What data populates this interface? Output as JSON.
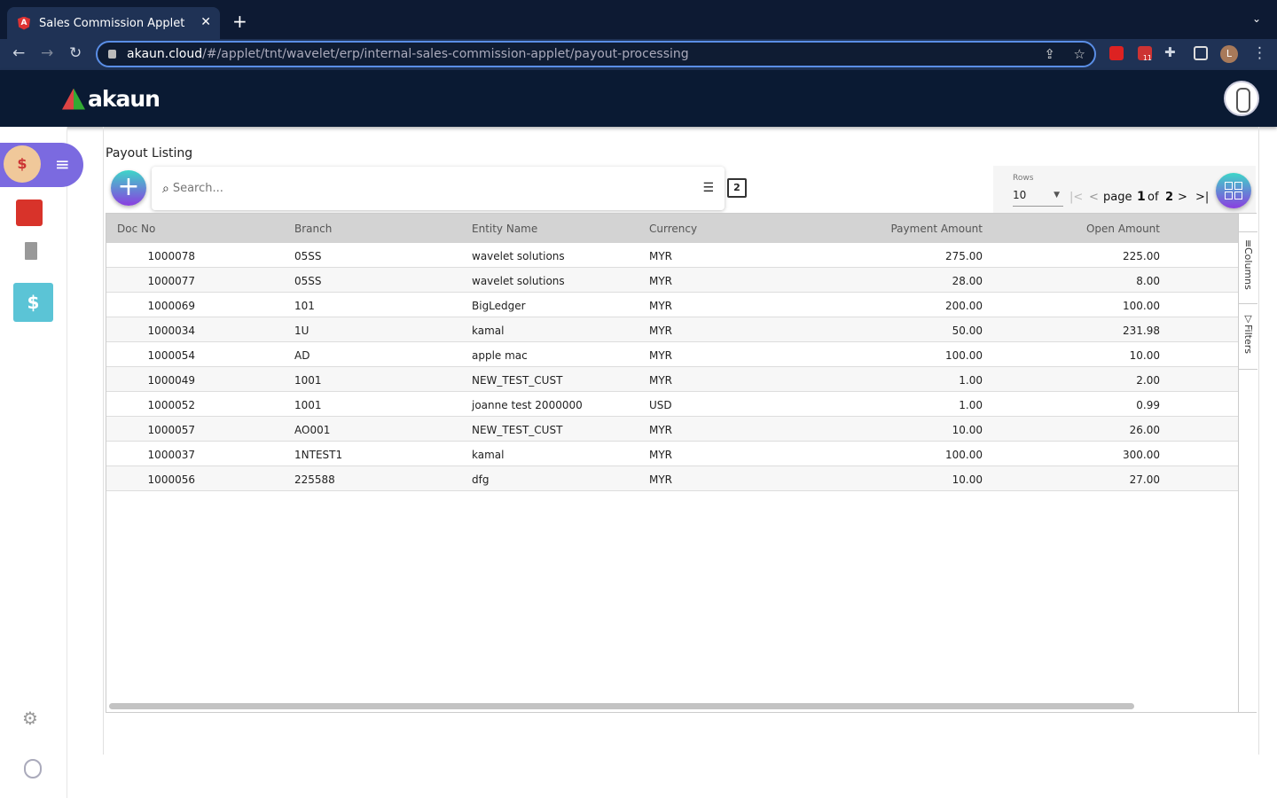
{
  "browser": {
    "tab_title": "Sales Commission Applet",
    "url_host": "akaun.cloud",
    "url_path": "/#/applet/tnt/wavelet/erp/internal-sales-commission-applet/payout-processing",
    "profile_initial": "L",
    "ext_badge": "11"
  },
  "app": {
    "logo_text": "akaun"
  },
  "page": {
    "title": "Payout Listing",
    "search_placeholder": "Search...",
    "copy_icon_label": "2"
  },
  "pager": {
    "rows_label": "Rows",
    "rows_value": "10",
    "page_word": "page",
    "page": "1",
    "of_word": "of",
    "total": "2"
  },
  "table": {
    "columns": [
      "Doc No",
      "Branch",
      "Entity Name",
      "Currency",
      "Payment Amount",
      "Open Amount"
    ],
    "rows": [
      [
        "1000078",
        "05SS",
        "wavelet solutions",
        "MYR",
        "275.00",
        "225.00"
      ],
      [
        "1000077",
        "05SS",
        "wavelet solutions",
        "MYR",
        "28.00",
        "8.00"
      ],
      [
        "1000069",
        "101",
        "BigLedger",
        "MYR",
        "200.00",
        "100.00"
      ],
      [
        "1000034",
        "1U",
        "kamal",
        "MYR",
        "50.00",
        "231.98"
      ],
      [
        "1000054",
        "AD",
        "apple mac",
        "MYR",
        "100.00",
        "10.00"
      ],
      [
        "1000049",
        "1001",
        "NEW_TEST_CUST",
        "MYR",
        "1.00",
        "2.00"
      ],
      [
        "1000052",
        "1001",
        "joanne test 2000000",
        "USD",
        "1.00",
        "0.99"
      ],
      [
        "1000057",
        "AO001",
        "NEW_TEST_CUST",
        "MYR",
        "10.00",
        "26.00"
      ],
      [
        "1000037",
        "1NTEST1",
        "kamal",
        "MYR",
        "100.00",
        "300.00"
      ],
      [
        "1000056",
        "225588",
        "dfg",
        "MYR",
        "10.00",
        "27.00"
      ]
    ]
  },
  "side_panel": {
    "columns": "Columns",
    "filters": "Filters"
  }
}
